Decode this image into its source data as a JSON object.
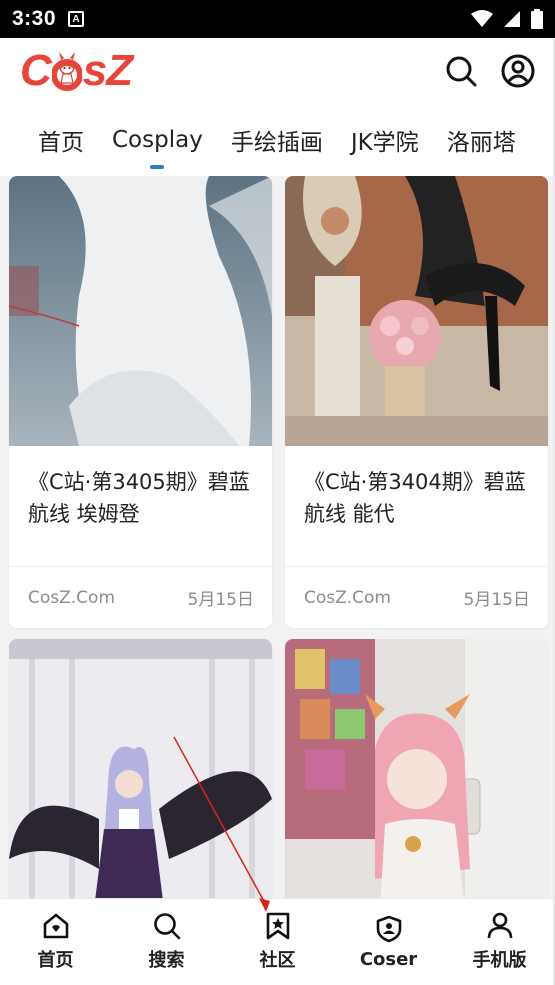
{
  "status_bar": {
    "time": "3:30",
    "notification_badge": "A"
  },
  "header": {
    "logo_prefix": "C",
    "logo_suffix": "sZ",
    "brand_color": "#e8443a",
    "icons": [
      "search-icon",
      "user-icon"
    ]
  },
  "tabs": [
    {
      "label": "首页",
      "active": false
    },
    {
      "label": "Cosplay",
      "active": true
    },
    {
      "label": "手绘插画",
      "active": false
    },
    {
      "label": "JK学院",
      "active": false
    },
    {
      "label": "洛丽塔",
      "active": false
    }
  ],
  "accent_color": "#2a7dbf",
  "cards": [
    {
      "title": "《C站·第3405期》碧蓝航线 埃姆登",
      "source": "CosZ.Com",
      "date": "5月15日"
    },
    {
      "title": "《C站·第3404期》碧蓝航线 能代",
      "source": "CosZ.Com",
      "date": "5月15日"
    },
    {
      "title": "",
      "source": "",
      "date": ""
    },
    {
      "title": "",
      "source": "",
      "date": ""
    }
  ],
  "bottom_nav": [
    {
      "label": "首页",
      "icon": "home-icon"
    },
    {
      "label": "搜索",
      "icon": "search-icon"
    },
    {
      "label": "社区",
      "icon": "bookmark-star-icon"
    },
    {
      "label": "Coser",
      "icon": "shield-user-icon"
    },
    {
      "label": "手机版",
      "icon": "user-icon"
    }
  ]
}
